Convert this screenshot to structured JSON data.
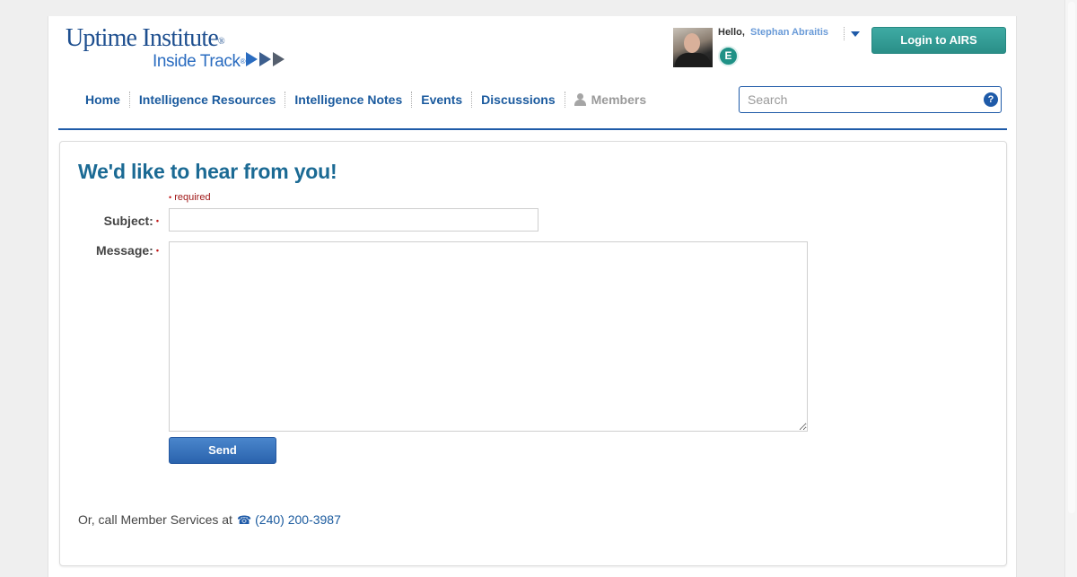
{
  "logo": {
    "main": "Uptime Institute",
    "sub": "Inside Track"
  },
  "user": {
    "greeting": "Hello,",
    "name": "Stephan Abraitis",
    "badge": "E"
  },
  "header": {
    "login_label": "Login to AIRS"
  },
  "nav": {
    "items": [
      {
        "label": "Home"
      },
      {
        "label": "Intelligence Resources"
      },
      {
        "label": "Intelligence Notes"
      },
      {
        "label": "Events"
      },
      {
        "label": "Discussions"
      },
      {
        "label": "Members"
      }
    ]
  },
  "search": {
    "placeholder": "Search",
    "help": "?"
  },
  "form": {
    "title": "We'd like to hear from you!",
    "required_note": "required",
    "subject_label": "Subject:",
    "message_label": "Message:",
    "subject_value": "",
    "message_value": "",
    "send_label": "Send"
  },
  "contact": {
    "text": "Or, call Member Services at",
    "phone": "(240) 200-3987"
  },
  "icons": {
    "phone": "phone-icon",
    "person": "person-icon",
    "help": "help-icon",
    "caret": "chevron-down-icon"
  },
  "colors": {
    "brand_blue": "#1e5aa8",
    "title_teal": "#1b6a94",
    "login_teal": "#2a8f88",
    "required_red": "#c01818"
  }
}
